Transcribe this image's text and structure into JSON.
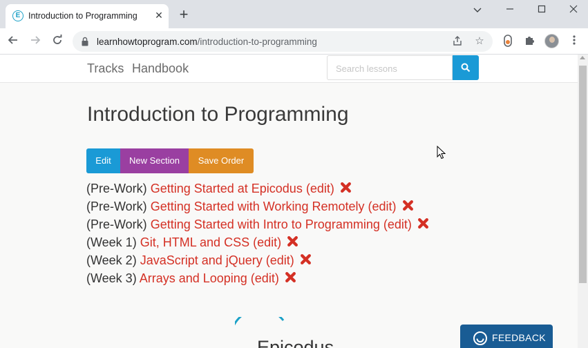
{
  "browser": {
    "tab_title": "Introduction to Programming",
    "favicon_letter": "E",
    "url_domain": "learnhowtoprogram.com",
    "url_path": "/introduction-to-programming"
  },
  "site_nav": {
    "links": [
      "Tracks",
      "Handbook"
    ],
    "search_placeholder": "Search lessons"
  },
  "page": {
    "title": "Introduction to Programming",
    "buttons": {
      "edit": "Edit",
      "new_section": "New Section",
      "save_order": "Save Order"
    },
    "lessons": [
      {
        "prefix": "(Pre-Work)",
        "title": "Getting Started at Epicodus (edit)"
      },
      {
        "prefix": "(Pre-Work)",
        "title": "Getting Started with Working Remotely (edit)"
      },
      {
        "prefix": "(Pre-Work)",
        "title": "Getting Started with Intro to Programming (edit)"
      },
      {
        "prefix": "(Week 1)",
        "title": "Git, HTML and CSS (edit)"
      },
      {
        "prefix": "(Week 2)",
        "title": "JavaScript and jQuery (edit)"
      },
      {
        "prefix": "(Week 3)",
        "title": "Arrays and Looping (edit)"
      }
    ],
    "logo_text": "Epicodus",
    "feedback": "FEEDBACK"
  },
  "colors": {
    "edit": "#1a9ad6",
    "new_section": "#9a3fa1",
    "save_order": "#df8c24",
    "link": "#d43024",
    "feedback": "#195c94"
  }
}
